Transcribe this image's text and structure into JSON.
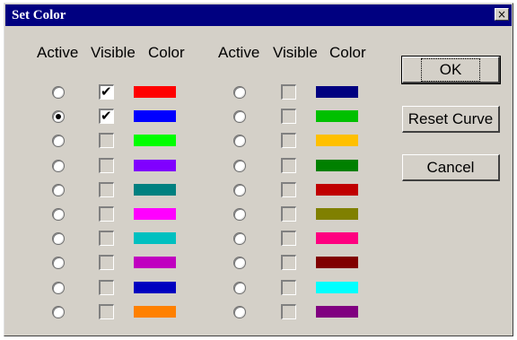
{
  "window": {
    "title": "Set Color",
    "close_glyph": "×"
  },
  "headers": {
    "active": "Active",
    "visible": "Visible",
    "color": "Color"
  },
  "columns": [
    {
      "rows": [
        {
          "active": false,
          "visible": true,
          "color": "#ff0000"
        },
        {
          "active": true,
          "visible": true,
          "color": "#0000ff"
        },
        {
          "active": false,
          "visible": false,
          "color": "#00ff00"
        },
        {
          "active": false,
          "visible": false,
          "color": "#8000ff"
        },
        {
          "active": false,
          "visible": false,
          "color": "#008080"
        },
        {
          "active": false,
          "visible": false,
          "color": "#ff00ff"
        },
        {
          "active": false,
          "visible": false,
          "color": "#00c0c0"
        },
        {
          "active": false,
          "visible": false,
          "color": "#c000c0"
        },
        {
          "active": false,
          "visible": false,
          "color": "#0000c0"
        },
        {
          "active": false,
          "visible": false,
          "color": "#ff8000"
        }
      ]
    },
    {
      "rows": [
        {
          "active": false,
          "visible": false,
          "color": "#000080"
        },
        {
          "active": false,
          "visible": false,
          "color": "#00c000"
        },
        {
          "active": false,
          "visible": false,
          "color": "#ffc000"
        },
        {
          "active": false,
          "visible": false,
          "color": "#008000"
        },
        {
          "active": false,
          "visible": false,
          "color": "#c00000"
        },
        {
          "active": false,
          "visible": false,
          "color": "#808000"
        },
        {
          "active": false,
          "visible": false,
          "color": "#ff0080"
        },
        {
          "active": false,
          "visible": false,
          "color": "#800000"
        },
        {
          "active": false,
          "visible": false,
          "color": "#00ffff"
        },
        {
          "active": false,
          "visible": false,
          "color": "#800080"
        }
      ]
    }
  ],
  "buttons": {
    "ok": "OK",
    "reset": "Reset Curve",
    "cancel": "Cancel"
  }
}
